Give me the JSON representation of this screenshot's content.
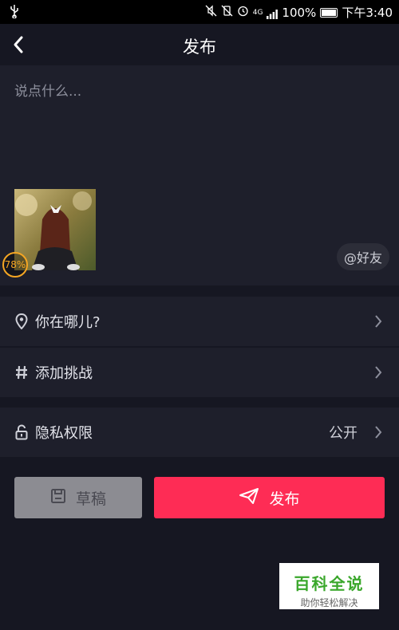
{
  "status_bar": {
    "network": "4G",
    "battery": "100%",
    "time": "下午3:40"
  },
  "header": {
    "title": "发布"
  },
  "compose": {
    "placeholder": "说点什么...",
    "upload_progress": "78%",
    "mention_label": "@好友"
  },
  "rows": {
    "location_label": "你在哪儿?",
    "challenge_label": "添加挑战",
    "privacy_label": "隐私权限",
    "privacy_value": "公开"
  },
  "buttons": {
    "draft_label": "草稿",
    "publish_label": "发布"
  },
  "watermark": {
    "title": "百科全说",
    "subtitle": "助你轻松解决"
  },
  "colors": {
    "accent": "#fe2c55",
    "background": "#161722",
    "surface": "#1e1f2b",
    "progress": "#f5a623"
  }
}
